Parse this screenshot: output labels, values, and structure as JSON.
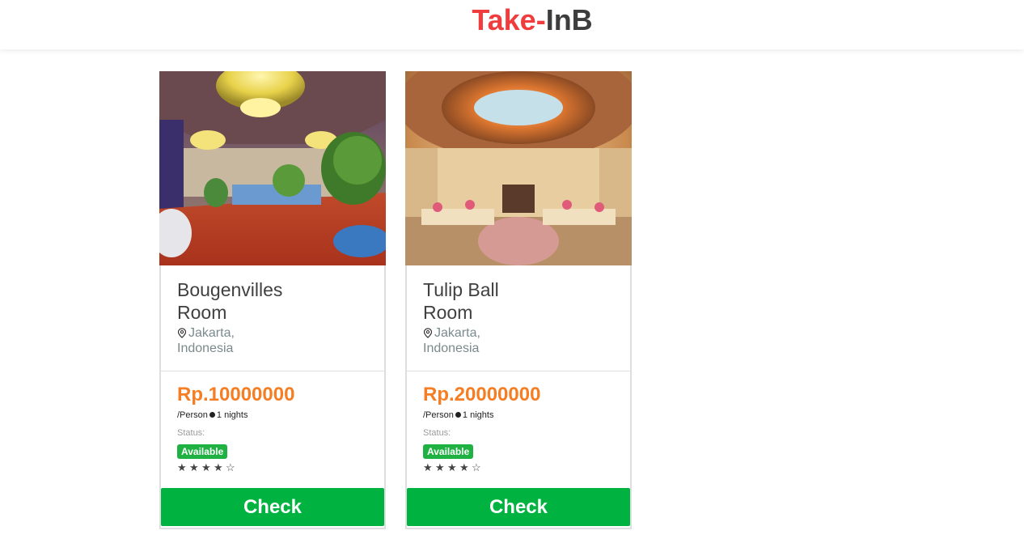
{
  "brand": {
    "part1": "Take-",
    "part2": "InB",
    "color1": "#f03c3c",
    "color2": "#3d3d3d"
  },
  "colors": {
    "price": "#f57e24",
    "badge": "#1fb141",
    "button": "#00b341"
  },
  "cards": [
    {
      "name": "Bougenvilles Room",
      "location_city": "Jakarta,",
      "location_country": "Indonesia",
      "price": "Rp.10000000",
      "per_unit": "/Person",
      "nights": "1 nights",
      "status_label": "Status:",
      "status": "Available",
      "rating": 4,
      "rating_max": 5,
      "button": "Check"
    },
    {
      "name": "Tulip Ball Room",
      "location_city": "Jakarta,",
      "location_country": "Indonesia",
      "price": "Rp.20000000",
      "per_unit": "/Person",
      "nights": "1 nights",
      "status_label": "Status:",
      "status": "Available",
      "rating": 4,
      "rating_max": 5,
      "button": "Check"
    }
  ]
}
